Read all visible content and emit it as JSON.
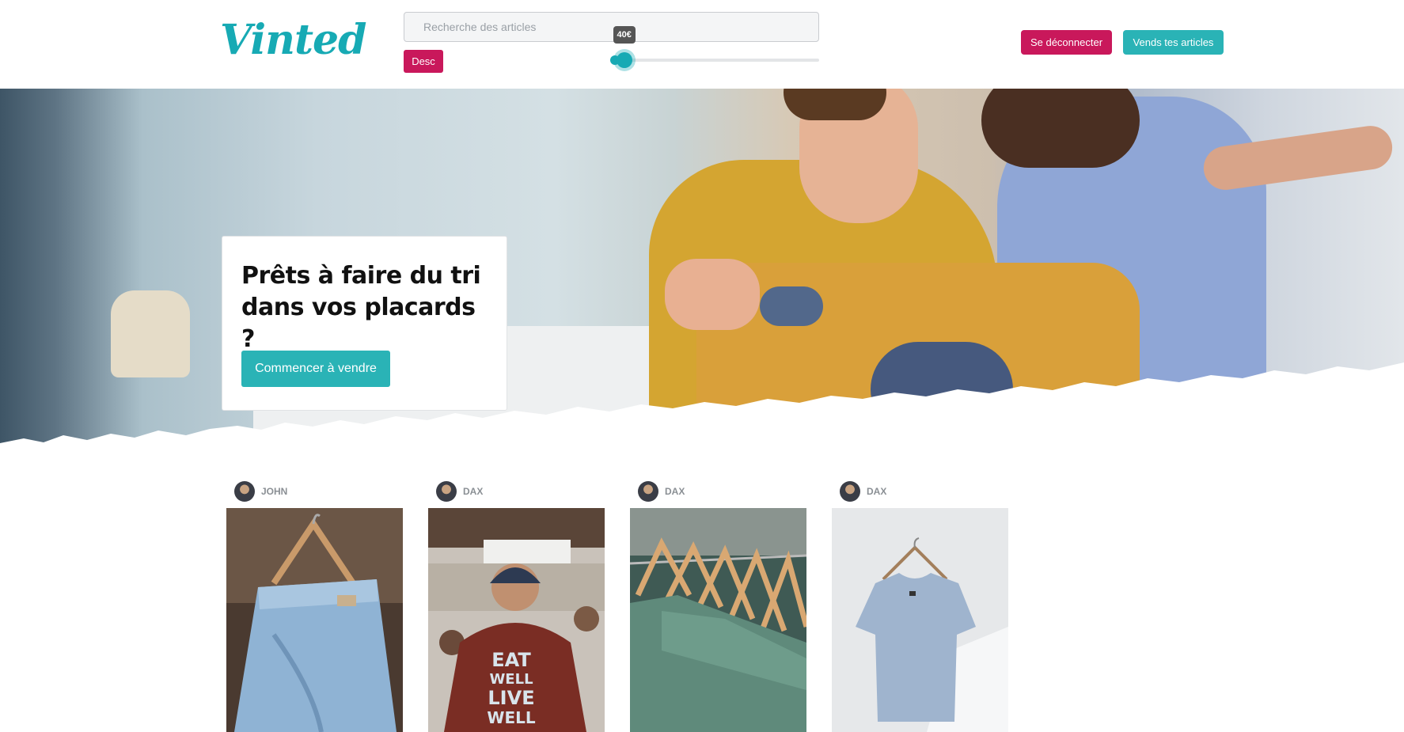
{
  "header": {
    "logo_text": "Vinted",
    "search_placeholder": "Recherche des articles",
    "sort_label": "Desc",
    "price_filter": {
      "value_label": "40€",
      "min_fraction": 0.0,
      "max_fraction": 0.06
    },
    "logout_label": "Se déconnecter",
    "sell_label": "Vends tes articles"
  },
  "hero": {
    "title": "Prêts à faire du tri dans vos placards ?",
    "cta_label": "Commencer à vendre"
  },
  "products": [
    {
      "seller": "JOHN",
      "photo": "denim-shorts-on-hanger"
    },
    {
      "seller": "DAX",
      "photo": "man-in-eat-well-live-well-tshirt"
    },
    {
      "seller": "DAX",
      "photo": "green-tshirts-on-rack"
    },
    {
      "seller": "DAX",
      "photo": "blue-tshirt-on-hanger"
    }
  ],
  "tshirt_print": [
    "EAT",
    "WELL",
    "LIVE",
    "WELL"
  ],
  "colors": {
    "brand_teal": "#17aab4",
    "accent_pink": "#c9185b",
    "button_teal": "#2ab3b6"
  }
}
